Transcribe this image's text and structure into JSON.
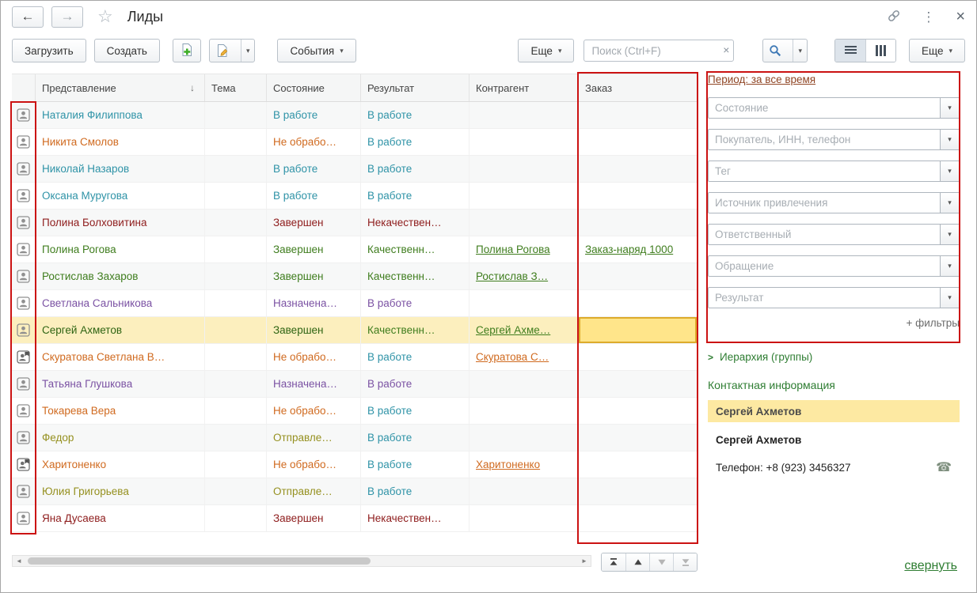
{
  "window": {
    "title": "Лиды"
  },
  "icons": {
    "back": "←",
    "forward": "→",
    "star": "☆",
    "kebab": "⋮",
    "close": "×",
    "caret": "▾",
    "sort_desc": "↓",
    "clear": "×",
    "scroll_left": "◄",
    "scroll_right": "►",
    "hierarchy_chevron": ">",
    "phone": "☎"
  },
  "toolbar": {
    "load": "Загрузить",
    "create": "Создать",
    "events": "События",
    "more_left": "Еще",
    "search_placeholder": "Поиск (Ctrl+F)",
    "more_right": "Еще"
  },
  "palette": {
    "teal": "#2f93a7",
    "orange": "#d06a1f",
    "green": "#3f7d1e",
    "green_dark": "#2e6413",
    "purple": "#7b52a3",
    "maroon": "#8e1c1c",
    "olive": "#95901f",
    "period_link": "#8f4524",
    "section_green": "#2e7d32",
    "selected_row_bg": "#fcefbe",
    "focus_cell_bg": "#ffe58a",
    "annotation_red": "#cb1212"
  },
  "table": {
    "columns": [
      "Представление",
      "Тема",
      "Состояние",
      "Результат",
      "Контрагент",
      "Заказ"
    ],
    "rows": [
      {
        "icon": "person",
        "name": "Наталия Филиппова",
        "nc": "teal",
        "state": "В работе",
        "sc": "teal",
        "result": "В работе",
        "rc": "teal",
        "party": "",
        "order": ""
      },
      {
        "icon": "person",
        "name": "Никита Смолов",
        "nc": "orange",
        "state": "Не обрабо…",
        "sc": "orange",
        "result": "В работе",
        "rc": "teal",
        "party": "",
        "order": ""
      },
      {
        "icon": "person",
        "name": "Николай Назаров",
        "nc": "teal",
        "state": "В работе",
        "sc": "teal",
        "result": "В работе",
        "rc": "teal",
        "party": "",
        "order": ""
      },
      {
        "icon": "person",
        "name": "Оксана Муругова",
        "nc": "teal",
        "state": "В работе",
        "sc": "teal",
        "result": "В работе",
        "rc": "teal",
        "party": "",
        "order": ""
      },
      {
        "icon": "person",
        "name": "Полина Болховитина",
        "nc": "maroon",
        "state": "Завершен",
        "sc": "maroon",
        "result": "Некачествен…",
        "rc": "maroon",
        "party": "",
        "order": ""
      },
      {
        "icon": "person",
        "name": "Полина Рогова",
        "nc": "green",
        "state": "Завершен",
        "sc": "green",
        "result": "Качественн…",
        "rc": "green",
        "party": "Полина Рогова",
        "party_link": true,
        "pc": "green",
        "order": "Заказ-наряд 1000",
        "order_link": true,
        "oc": "green"
      },
      {
        "icon": "person",
        "name": "Ростислав Захаров",
        "nc": "green",
        "state": "Завершен",
        "sc": "green",
        "result": "Качественн…",
        "rc": "green",
        "party": "Ростислав З…",
        "party_link": true,
        "pc": "green",
        "order": ""
      },
      {
        "icon": "person",
        "name": "Светлана Сальникова",
        "nc": "purple",
        "state": "Назначена…",
        "sc": "purple",
        "result": "В работе",
        "rc": "purple",
        "party": "",
        "order": ""
      },
      {
        "icon": "person",
        "name": "Сергей Ахметов",
        "nc": "green_dark",
        "state": "Завершен",
        "sc": "green_dark",
        "result": "Качественн…",
        "rc": "green",
        "party": "Сергей Ахме…",
        "party_link": true,
        "pc": "green",
        "order": "",
        "selected": true
      },
      {
        "icon": "person-flag",
        "name": "Скуратова Светлана В…",
        "nc": "orange",
        "state": "Не обрабо…",
        "sc": "orange",
        "result": "В работе",
        "rc": "teal",
        "party": "Скуратова С…",
        "party_link": true,
        "pc": "orange",
        "order": ""
      },
      {
        "icon": "person",
        "name": "Татьяна Глушкова",
        "nc": "purple",
        "state": "Назначена…",
        "sc": "purple",
        "result": "В работе",
        "rc": "purple",
        "party": "",
        "order": ""
      },
      {
        "icon": "person",
        "name": "Токарева Вера",
        "nc": "orange",
        "state": "Не обрабо…",
        "sc": "orange",
        "result": "В работе",
        "rc": "teal",
        "party": "",
        "order": ""
      },
      {
        "icon": "person",
        "name": "Федор",
        "nc": "olive",
        "state": "Отправле…",
        "sc": "olive",
        "result": "В работе",
        "rc": "teal",
        "party": "",
        "order": ""
      },
      {
        "icon": "person-flag",
        "name": "Харитоненко",
        "nc": "orange",
        "state": "Не обрабо…",
        "sc": "orange",
        "result": "В работе",
        "rc": "teal",
        "party": "Харитоненко",
        "party_link": true,
        "pc": "orange",
        "order": ""
      },
      {
        "icon": "person",
        "name": "Юлия Григорьева",
        "nc": "olive",
        "state": "Отправле…",
        "sc": "olive",
        "result": "В работе",
        "rc": "teal",
        "party": "",
        "order": ""
      },
      {
        "icon": "person",
        "name": "Яна Дусаева",
        "nc": "maroon",
        "state": "Завершен",
        "sc": "maroon",
        "result": "Некачествен…",
        "rc": "maroon",
        "party": "",
        "order": ""
      }
    ]
  },
  "filters": {
    "period_label": "Период: за все время",
    "fields": [
      "Состояние",
      "Покупатель, ИНН, телефон",
      "Тег",
      "Источник привлечения",
      "Ответственный",
      "Обращение",
      "Результат"
    ],
    "more_filters": "+ фильтры"
  },
  "hierarchy_label": "Иерархия (группы)",
  "contact": {
    "header": "Контактная информация",
    "selected_name": "Сергей Ахметов",
    "name": "Сергей Ахметов",
    "phone": "Телефон: +8 (923) 3456327"
  },
  "footer": {
    "collapse": "свернуть"
  }
}
